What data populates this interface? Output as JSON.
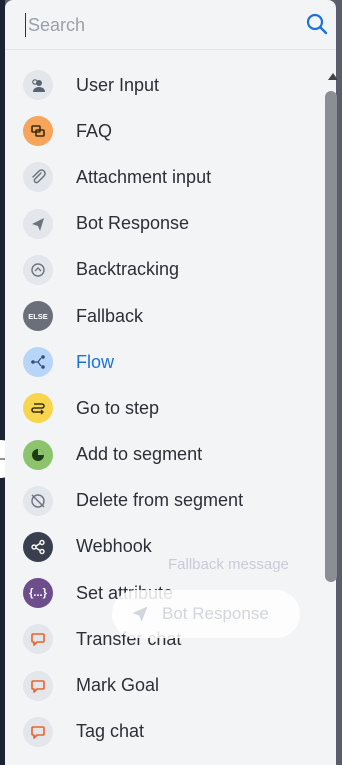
{
  "search": {
    "placeholder": "Search"
  },
  "items": [
    {
      "label": "User Input",
      "icon": "user-input-icon",
      "bg": "#e3e6ea",
      "fg": "#5b6370"
    },
    {
      "label": "FAQ",
      "icon": "faq-icon",
      "bg": "#f6a55a",
      "fg": "#3a2a12"
    },
    {
      "label": "Attachment input",
      "icon": "paperclip-icon",
      "bg": "#e3e6ea",
      "fg": "#6b7280"
    },
    {
      "label": "Bot Response",
      "icon": "send-icon",
      "bg": "#e3e6ea",
      "fg": "#6b7280"
    },
    {
      "label": "Backtracking",
      "icon": "backtrack-icon",
      "bg": "#e3e6ea",
      "fg": "#6b7280"
    },
    {
      "label": "Fallback",
      "icon": "else-icon",
      "bg": "#6b6f7a",
      "fg": "#ffffff",
      "text": "ELSE"
    },
    {
      "label": "Flow",
      "icon": "flow-icon",
      "bg": "#b7d6f7",
      "fg": "#2f4e7a",
      "active": true
    },
    {
      "label": "Go to step",
      "icon": "goto-step-icon",
      "bg": "#f7d64e",
      "fg": "#3a3210"
    },
    {
      "label": "Add to segment",
      "icon": "segment-add-icon",
      "bg": "#8cc46e",
      "fg": "#1f3a16"
    },
    {
      "label": "Delete from segment",
      "icon": "segment-delete-icon",
      "bg": "#e3e6ea",
      "fg": "#6b7280"
    },
    {
      "label": "Webhook",
      "icon": "share-icon",
      "bg": "#3a3f50",
      "fg": "#ffffff"
    },
    {
      "label": "Set attribute",
      "icon": "braces-icon",
      "bg": "#6e4d8c",
      "fg": "#ffffff",
      "text": "{...}"
    },
    {
      "label": "Transfer chat",
      "icon": "chat-bubble-icon",
      "bg": "#e3e6ea",
      "fg": "#e8632a"
    },
    {
      "label": "Mark Goal",
      "icon": "chat-bubble-icon",
      "bg": "#e3e6ea",
      "fg": "#e8632a"
    },
    {
      "label": "Tag chat",
      "icon": "chat-bubble-icon",
      "bg": "#e3e6ea",
      "fg": "#e8632a"
    }
  ],
  "background": {
    "fallback_label": "Fallback message",
    "bot_response_label": "Bot Response"
  }
}
